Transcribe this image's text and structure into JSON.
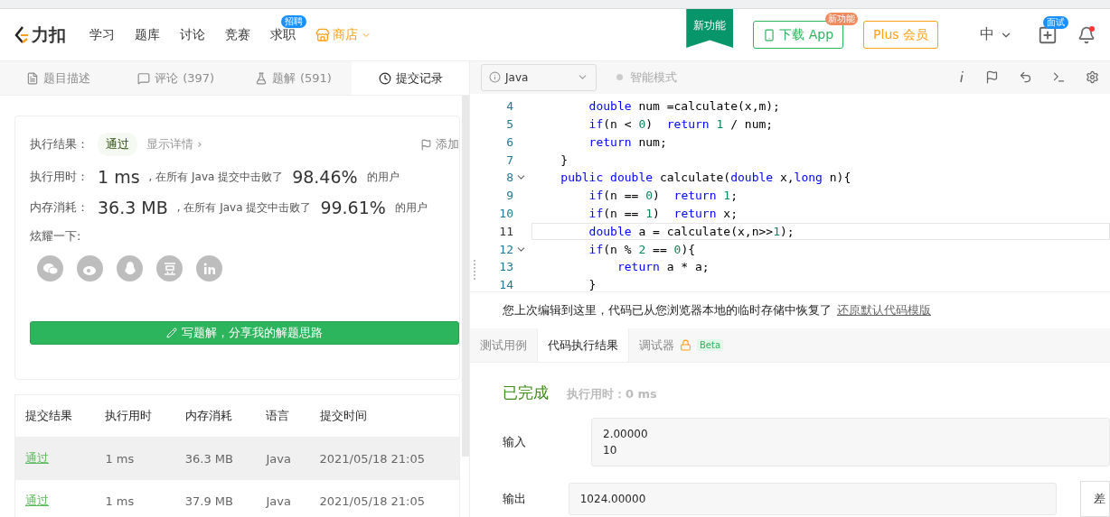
{
  "nav": {
    "logo": "力扣",
    "items": [
      {
        "label": "学习"
      },
      {
        "label": "题库"
      },
      {
        "label": "讨论"
      },
      {
        "label": "竞赛"
      },
      {
        "label": "求职",
        "badge": "招聘"
      }
    ],
    "shop": "商店",
    "ribbon": "新功能",
    "download": {
      "label": "下载 App",
      "badge": "新功能"
    },
    "plus": "Plus 会员",
    "language": "中",
    "interview_badge": "面试"
  },
  "left_tabs": [
    {
      "label": "题目描述",
      "kind": "doc",
      "selected": false
    },
    {
      "label": "评论",
      "count": "(397)",
      "kind": "comment",
      "selected": false
    },
    {
      "label": "题解",
      "count": "(591)",
      "kind": "flask",
      "selected": false
    },
    {
      "label": "提交记录",
      "kind": "clock",
      "selected": true
    }
  ],
  "result": {
    "label": "执行结果：",
    "status": "通过",
    "details": "显示详情 ›",
    "add": "添加",
    "stats": [
      {
        "label": "执行用时：",
        "value": "1 ms",
        "text": ", 在所有 Java 提交中击败了",
        "percent": "98.46%",
        "suffix": "的用户"
      },
      {
        "label": "内存消耗：",
        "value": "36.3 MB",
        "text": ", 在所有 Java 提交中击败了",
        "percent": "99.61%",
        "suffix": "的用户"
      }
    ],
    "share_label": "炫耀一下:",
    "share_buttons": [
      {
        "kind": "wechat"
      },
      {
        "kind": "weibo"
      },
      {
        "kind": "qq"
      },
      {
        "kind": "douban"
      },
      {
        "kind": "linkedin"
      }
    ],
    "write_button": "写题解，分享我的解题思路"
  },
  "table": {
    "columns": [
      "提交结果",
      "执行用时",
      "内存消耗",
      "语言",
      "提交时间"
    ],
    "rows": [
      {
        "cells": [
          "通过",
          "1 ms",
          "36.3 MB",
          "Java",
          "2021/05/18 21:05"
        ],
        "selected": true
      },
      {
        "cells": [
          "通过",
          "1 ms",
          "37.9 MB",
          "Java",
          "2021/05/18 21:05"
        ],
        "selected": false
      }
    ]
  },
  "editor": {
    "language": "Java",
    "smart_mode": {
      "label": "智能模式",
      "on": false
    },
    "lines": [
      {
        "n": "4",
        "fold": false,
        "current": false,
        "tokens": [
          {
            "kind": "kw",
            "t": "        double"
          },
          {
            "kind": "p",
            "t": " num =calculate(x,m);"
          }
        ]
      },
      {
        "n": "5",
        "fold": false,
        "current": false,
        "tokens": [
          {
            "kind": "kw",
            "t": "        if"
          },
          {
            "kind": "p",
            "t": "(n < "
          },
          {
            "kind": "num",
            "t": "0"
          },
          {
            "kind": "p",
            "t": ")  "
          },
          {
            "kind": "kw",
            "t": "return "
          },
          {
            "kind": "num",
            "t": "1"
          },
          {
            "kind": "p",
            "t": " / num;"
          }
        ]
      },
      {
        "n": "6",
        "fold": false,
        "current": false,
        "tokens": [
          {
            "kind": "kw",
            "t": "        return"
          },
          {
            "kind": "p",
            "t": " num;"
          }
        ]
      },
      {
        "n": "7",
        "fold": false,
        "current": false,
        "tokens": [
          {
            "kind": "p",
            "t": "    }"
          }
        ]
      },
      {
        "n": "8",
        "fold": true,
        "current": false,
        "tokens": [
          {
            "kind": "kw",
            "t": "    public double"
          },
          {
            "kind": "p",
            "t": " calculate("
          },
          {
            "kind": "kw",
            "t": "double"
          },
          {
            "kind": "p",
            "t": " x,"
          },
          {
            "kind": "kw",
            "t": "long"
          },
          {
            "kind": "p",
            "t": " n){"
          }
        ]
      },
      {
        "n": "9",
        "fold": false,
        "current": false,
        "tokens": [
          {
            "kind": "kw",
            "t": "        if"
          },
          {
            "kind": "p",
            "t": "(n == "
          },
          {
            "kind": "num",
            "t": "0"
          },
          {
            "kind": "p",
            "t": ")  "
          },
          {
            "kind": "kw",
            "t": "return "
          },
          {
            "kind": "num",
            "t": "1"
          },
          {
            "kind": "p",
            "t": ";"
          }
        ]
      },
      {
        "n": "10",
        "fold": false,
        "current": false,
        "tokens": [
          {
            "kind": "kw",
            "t": "        if"
          },
          {
            "kind": "p",
            "t": "(n == "
          },
          {
            "kind": "num",
            "t": "1"
          },
          {
            "kind": "p",
            "t": ")  "
          },
          {
            "kind": "kw",
            "t": "return"
          },
          {
            "kind": "p",
            "t": " x;"
          }
        ]
      },
      {
        "n": "11",
        "fold": false,
        "current": true,
        "tokens": [
          {
            "kind": "kw",
            "t": "        double"
          },
          {
            "kind": "p",
            "t": " a = calculate(x,n>>"
          },
          {
            "kind": "num",
            "t": "1"
          },
          {
            "kind": "p",
            "t": ");"
          }
        ]
      },
      {
        "n": "12",
        "fold": true,
        "current": false,
        "tokens": [
          {
            "kind": "kw",
            "t": "        if"
          },
          {
            "kind": "p",
            "t": "(n % "
          },
          {
            "kind": "num",
            "t": "2"
          },
          {
            "kind": "p",
            "t": " == "
          },
          {
            "kind": "num",
            "t": "0"
          },
          {
            "kind": "p",
            "t": "){"
          }
        ]
      },
      {
        "n": "13",
        "fold": false,
        "current": false,
        "tokens": [
          {
            "kind": "kw",
            "t": "            return"
          },
          {
            "kind": "p",
            "t": " a * a;"
          }
        ]
      },
      {
        "n": "14",
        "fold": false,
        "current": false,
        "tokens": [
          {
            "kind": "p",
            "t": "        }"
          }
        ]
      }
    ],
    "notice": "您上次编辑到这里，代码已从您浏览器本地的临时存储中恢复了",
    "restore_link": "还原默认代码模版"
  },
  "bottom_tabs": [
    {
      "label": "测试用例",
      "selected": false
    },
    {
      "label": "代码执行结果",
      "selected": true
    },
    {
      "label": "调试器",
      "selected": false,
      "locked": true,
      "tag": "Beta"
    }
  ],
  "run": {
    "status": "已完成",
    "time": "执行用时：0 ms",
    "input_label": "输入",
    "input": [
      "2.00000",
      "10"
    ],
    "output_label": "输出",
    "output": [
      "1024.00000"
    ],
    "diff_button": "差"
  }
}
